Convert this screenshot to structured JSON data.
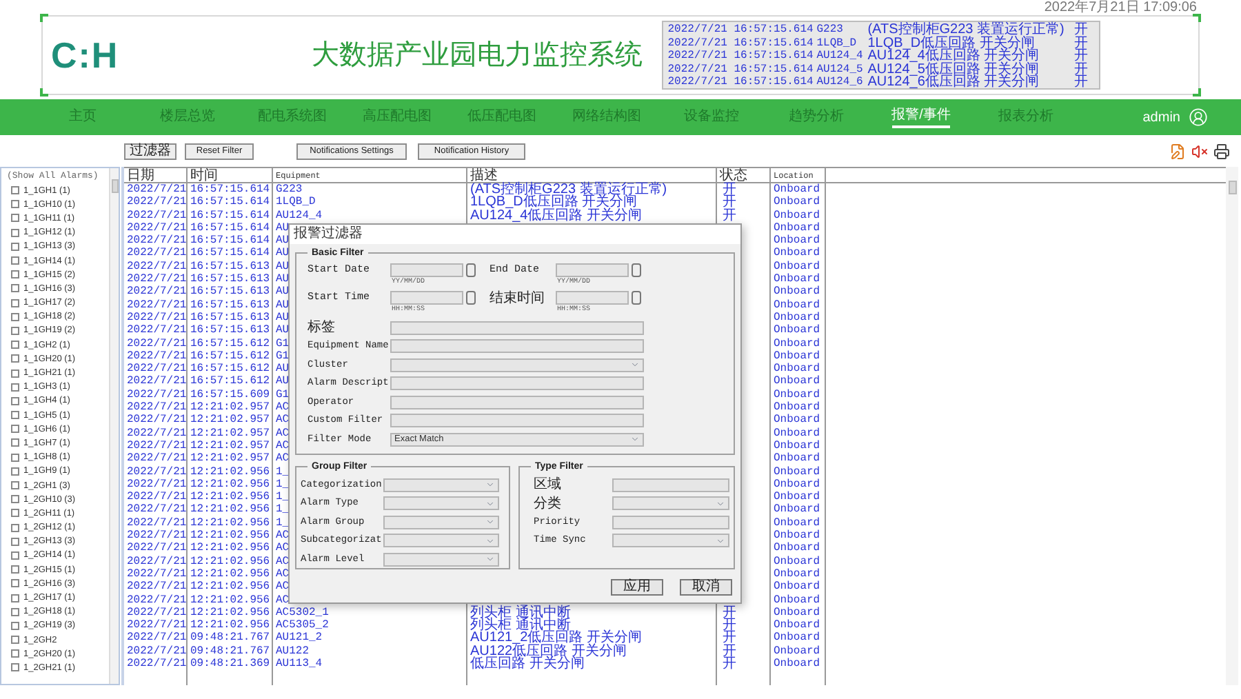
{
  "clock": "2022年7月21日 17:09:06",
  "header": {
    "logo": "C:H",
    "title": "大数据产业园电力监控系统"
  },
  "ticker": [
    {
      "time": "2022/7/21 16:57:15.614",
      "equipment": "G223",
      "description": "(ATS控制柜G223 装置运行正常)",
      "status": "开"
    },
    {
      "time": "2022/7/21 16:57:15.614",
      "equipment": "1LQB_D",
      "description": "1LQB_D低压回路 开关分闸",
      "status": "开"
    },
    {
      "time": "2022/7/21 16:57:15.614",
      "equipment": "AU124_4",
      "description": "AU124_4低压回路 开关分闸",
      "status": "开"
    },
    {
      "time": "2022/7/21 16:57:15.614",
      "equipment": "AU124_5",
      "description": "AU124_5低压回路 开关分闸",
      "status": "开"
    },
    {
      "time": "2022/7/21 16:57:15.614",
      "equipment": "AU124_6",
      "description": "AU124_6低压回路 开关分闸",
      "status": "开"
    }
  ],
  "nav": {
    "items": [
      {
        "label": "主页",
        "selected": false
      },
      {
        "label": "楼层总览",
        "selected": false
      },
      {
        "label": "配电系统图",
        "selected": false
      },
      {
        "label": "高压配电图",
        "selected": false
      },
      {
        "label": "低压配电图",
        "selected": false
      },
      {
        "label": "网络结构图",
        "selected": false
      },
      {
        "label": "设备监控",
        "selected": false
      },
      {
        "label": "趋势分析",
        "selected": false
      },
      {
        "label": "报警/事件",
        "selected": true
      },
      {
        "label": "报表分析",
        "selected": false
      }
    ],
    "user": "admin"
  },
  "toolbar": {
    "buttons": [
      "过滤器",
      "Reset Filter",
      "Notifications Settings",
      "Notification History"
    ]
  },
  "sidebar": {
    "show_all": "(Show All Alarms)",
    "items": [
      {
        "label": "1_1GH1 (1)",
        "checked": false
      },
      {
        "label": "1_1GH10 (1)",
        "checked": false
      },
      {
        "label": "1_1GH11 (1)",
        "checked": false
      },
      {
        "label": "1_1GH12 (1)",
        "checked": false
      },
      {
        "label": "1_1GH13 (3)",
        "checked": false
      },
      {
        "label": "1_1GH14 (1)",
        "checked": false
      },
      {
        "label": "1_1GH15 (2)",
        "checked": false
      },
      {
        "label": "1_1GH16 (3)",
        "checked": false
      },
      {
        "label": "1_1GH17 (2)",
        "checked": false
      },
      {
        "label": "1_1GH18 (2)",
        "checked": false
      },
      {
        "label": "1_1GH19 (2)",
        "checked": false
      },
      {
        "label": "1_1GH2 (1)",
        "checked": false
      },
      {
        "label": "1_1GH20 (1)",
        "checked": false
      },
      {
        "label": "1_1GH21 (1)",
        "checked": false
      },
      {
        "label": "1_1GH3 (1)",
        "checked": false
      },
      {
        "label": "1_1GH4 (1)",
        "checked": false
      },
      {
        "label": "1_1GH5 (1)",
        "checked": false
      },
      {
        "label": "1_1GH6 (1)",
        "checked": false
      },
      {
        "label": "1_1GH7 (1)",
        "checked": false
      },
      {
        "label": "1_1GH8 (1)",
        "checked": false
      },
      {
        "label": "1_1GH9 (1)",
        "checked": false
      },
      {
        "label": "1_2GH1 (3)",
        "checked": false
      },
      {
        "label": "1_2GH10 (3)",
        "checked": false
      },
      {
        "label": "1_2GH11 (1)",
        "checked": false
      },
      {
        "label": "1_2GH12 (1)",
        "checked": false
      },
      {
        "label": "1_2GH13 (3)",
        "checked": false
      },
      {
        "label": "1_2GH14 (1)",
        "checked": false
      },
      {
        "label": "1_2GH15 (1)",
        "checked": false
      },
      {
        "label": "1_2GH16 (3)",
        "checked": false
      },
      {
        "label": "1_2GH17 (1)",
        "checked": false
      },
      {
        "label": "1_2GH18 (1)",
        "checked": false
      },
      {
        "label": "1_2GH19 (3)",
        "checked": false
      },
      {
        "label": "1_2GH2",
        "checked": false
      },
      {
        "label": "1_2GH20 (1)",
        "checked": false
      },
      {
        "label": "1_2GH21 (1)",
        "checked": false
      }
    ]
  },
  "table": {
    "columns": [
      "日期",
      "时间",
      "Equipment",
      "描述",
      "状态",
      "Location"
    ],
    "rows": [
      {
        "date": "2022/7/21",
        "time": "16:57:15.614",
        "equipment": "G223",
        "description": "(ATS控制柜G223 装置运行正常)",
        "status": "开",
        "location": "Onboard"
      },
      {
        "date": "2022/7/21",
        "time": "16:57:15.614",
        "equipment": "1LQB_D",
        "description": "1LQB_D低压回路 开关分闸",
        "status": "开",
        "location": "Onboard"
      },
      {
        "date": "2022/7/21",
        "time": "16:57:15.614",
        "equipment": "AU124_4",
        "description": "AU124_4低压回路 开关分闸",
        "status": "开",
        "location": "Onboard"
      },
      {
        "date": "2022/7/21",
        "time": "16:57:15.614",
        "equipment": "AU",
        "location": "Onboard"
      },
      {
        "date": "2022/7/21",
        "time": "16:57:15.614",
        "equipment": "AU",
        "location": "Onboard"
      },
      {
        "date": "2022/7/21",
        "time": "16:57:15.614",
        "equipment": "AU",
        "location": "Onboard"
      },
      {
        "date": "2022/7/21",
        "time": "16:57:15.613",
        "equipment": "AU",
        "location": "Onboard"
      },
      {
        "date": "2022/7/21",
        "time": "16:57:15.613",
        "equipment": "AU",
        "location": "Onboard"
      },
      {
        "date": "2022/7/21",
        "time": "16:57:15.613",
        "equipment": "AU",
        "location": "Onboard"
      },
      {
        "date": "2022/7/21",
        "time": "16:57:15.613",
        "equipment": "AU",
        "location": "Onboard"
      },
      {
        "date": "2022/7/21",
        "time": "16:57:15.613",
        "equipment": "AU",
        "location": "Onboard"
      },
      {
        "date": "2022/7/21",
        "time": "16:57:15.613",
        "equipment": "AU",
        "location": "Onboard"
      },
      {
        "date": "2022/7/21",
        "time": "16:57:15.612",
        "equipment": "G1",
        "location": "Onboard"
      },
      {
        "date": "2022/7/21",
        "time": "16:57:15.612",
        "equipment": "G1",
        "location": "Onboard"
      },
      {
        "date": "2022/7/21",
        "time": "16:57:15.612",
        "equipment": "AU",
        "location": "Onboard"
      },
      {
        "date": "2022/7/21",
        "time": "16:57:15.612",
        "equipment": "AU",
        "location": "Onboard"
      },
      {
        "date": "2022/7/21",
        "time": "16:57:15.609",
        "equipment": "G1",
        "location": "Onboard"
      },
      {
        "date": "2022/7/21",
        "time": "12:21:02.957",
        "equipment": "AC",
        "location": "Onboard"
      },
      {
        "date": "2022/7/21",
        "time": "12:21:02.957",
        "equipment": "AC",
        "location": "Onboard"
      },
      {
        "date": "2022/7/21",
        "time": "12:21:02.957",
        "equipment": "AC",
        "location": "Onboard"
      },
      {
        "date": "2022/7/21",
        "time": "12:21:02.957",
        "equipment": "AC",
        "location": "Onboard"
      },
      {
        "date": "2022/7/21",
        "time": "12:21:02.957",
        "equipment": "AC",
        "location": "Onboard"
      },
      {
        "date": "2022/7/21",
        "time": "12:21:02.956",
        "equipment": "1_",
        "location": "Onboard"
      },
      {
        "date": "2022/7/21",
        "time": "12:21:02.956",
        "equipment": "1_",
        "location": "Onboard"
      },
      {
        "date": "2022/7/21",
        "time": "12:21:02.956",
        "equipment": "1_",
        "location": "Onboard"
      },
      {
        "date": "2022/7/21",
        "time": "12:21:02.956",
        "equipment": "1_",
        "location": "Onboard"
      },
      {
        "date": "2022/7/21",
        "time": "12:21:02.956",
        "equipment": "1_",
        "location": "Onboard"
      },
      {
        "date": "2022/7/21",
        "time": "12:21:02.956",
        "equipment": "AC",
        "location": "Onboard"
      },
      {
        "date": "2022/7/21",
        "time": "12:21:02.956",
        "equipment": "AC",
        "location": "Onboard"
      },
      {
        "date": "2022/7/21",
        "time": "12:21:02.956",
        "equipment": "AC",
        "location": "Onboard"
      },
      {
        "date": "2022/7/21",
        "time": "12:21:02.956",
        "equipment": "AC",
        "location": "Onboard"
      },
      {
        "date": "2022/7/21",
        "time": "12:21:02.956",
        "equipment": "AC",
        "location": "Onboard"
      },
      {
        "date": "2022/7/21",
        "time": "12:21:02.956",
        "equipment": "AC",
        "location": "Onboard"
      },
      {
        "date": "2022/7/21",
        "time": "12:21:02.956",
        "equipment": "AC5302_1",
        "description": "列头柜 通讯中断",
        "status": "开",
        "location": "Onboard"
      },
      {
        "date": "2022/7/21",
        "time": "12:21:02.956",
        "equipment": "AC5305_2",
        "description": "列头柜 通讯中断",
        "status": "开",
        "location": "Onboard"
      },
      {
        "date": "2022/7/21",
        "time": "09:48:21.767",
        "equipment": "AU121_2",
        "description": "AU121_2低压回路 开关分闸",
        "status": "开",
        "location": "Onboard"
      },
      {
        "date": "2022/7/21",
        "time": "09:48:21.767",
        "equipment": "AU122",
        "description": "AU122低压回路 开关分闸",
        "status": "开",
        "location": "Onboard"
      },
      {
        "date": "2022/7/21",
        "time": "09:48:21.369",
        "equipment": "AU113_4",
        "description": "低压回路 开关分闸",
        "status": "开",
        "location": "Onboard"
      }
    ]
  },
  "dialog": {
    "title": "报警过滤器",
    "basic_filter": {
      "legend": "Basic Filter",
      "range_fields": [
        {
          "label": "Start Date",
          "hint": "YY/MM/DD"
        },
        {
          "label": "End Date",
          "hint": "YY/MM/DD"
        },
        {
          "label": "Start Time",
          "hint": "HH:MM:SS"
        },
        {
          "label": "结束时间",
          "hint": "HH:MM:SS"
        }
      ],
      "fields": [
        {
          "label": "标签",
          "kind": "text"
        },
        {
          "label": "Equipment Name",
          "kind": "text"
        },
        {
          "label": "Cluster",
          "kind": "select"
        },
        {
          "label": "Alarm Descript",
          "kind": "text"
        },
        {
          "label": "Operator",
          "kind": "text"
        },
        {
          "label": "Custom Filter",
          "kind": "text"
        },
        {
          "label": "Filter Mode",
          "kind": "select",
          "value": "Exact Match"
        }
      ]
    },
    "group_filter": {
      "legend": "Group Filter",
      "fields": [
        {
          "label": "Categorization",
          "kind": "select"
        },
        {
          "label": "Alarm Type",
          "kind": "select"
        },
        {
          "label": "Alarm Group",
          "kind": "select"
        },
        {
          "label": "Subcategorizat",
          "kind": "select"
        },
        {
          "label": "Alarm Level",
          "kind": "select"
        }
      ]
    },
    "type_filter": {
      "legend": "Type Filter",
      "fields": [
        {
          "label": "区域",
          "kind": "text"
        },
        {
          "label": "分类",
          "kind": "select"
        },
        {
          "label": "Priority",
          "kind": "text"
        },
        {
          "label": "Time Sync",
          "kind": "select"
        }
      ]
    },
    "buttons": [
      "应用",
      "取消"
    ]
  }
}
